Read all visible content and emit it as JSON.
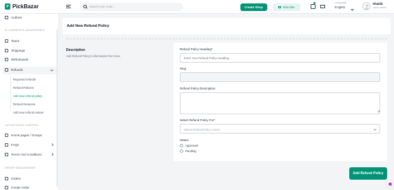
{
  "app": {
    "logo_text": "PickBazar"
  },
  "header": {
    "search_placeholder": "Search your route...",
    "create_shop_label": "Create Shop",
    "visit_site_label": "Visit Site",
    "language_label": "Language",
    "language_value": "English",
    "user_name": "Shakib",
    "user_role": "super admin"
  },
  "sidebar": {
    "top_item": "Authors",
    "section_ecommerce": "E-COMMERCE MANAGEMENT",
    "ecommerce_items": [
      "Taxes",
      "Shippings",
      "Withdrawals",
      "Refunds"
    ],
    "refund_sub_items": [
      "Reported refunds",
      "Refund Policies",
      "Add new refund policy",
      "Refund Reasons",
      "Add new refund reason"
    ],
    "active_sub_index": 2,
    "section_layout": "LAYOUT/PAGE CONTROL",
    "layout_items": [
      "Home pages / Groups",
      "FAQs",
      "Terms And Conditions"
    ],
    "section_order": "ORDER MANAGEMENT",
    "order_items": [
      "Orders",
      "Create Order"
    ]
  },
  "page": {
    "title": "Add New Refund Policy",
    "description_title": "Description",
    "description_text": "Add Refund Policy's information from here.",
    "form": {
      "heading_label": "Refund Policy Heading*",
      "heading_placeholder": "Enter Your Refund Policy Heading.",
      "slug_label": "Slug",
      "slug_value": "",
      "description_label": "Refund Policy Description",
      "for_label": "Select Refund Policy For*",
      "for_placeholder": "Select Refund Policy Users",
      "status_label": "Status",
      "status_options": [
        "Approved",
        "Pending"
      ]
    },
    "submit_label": "Add Refund Policy"
  },
  "colors": {
    "accent": "#019376",
    "background": "#f3f4f6"
  }
}
